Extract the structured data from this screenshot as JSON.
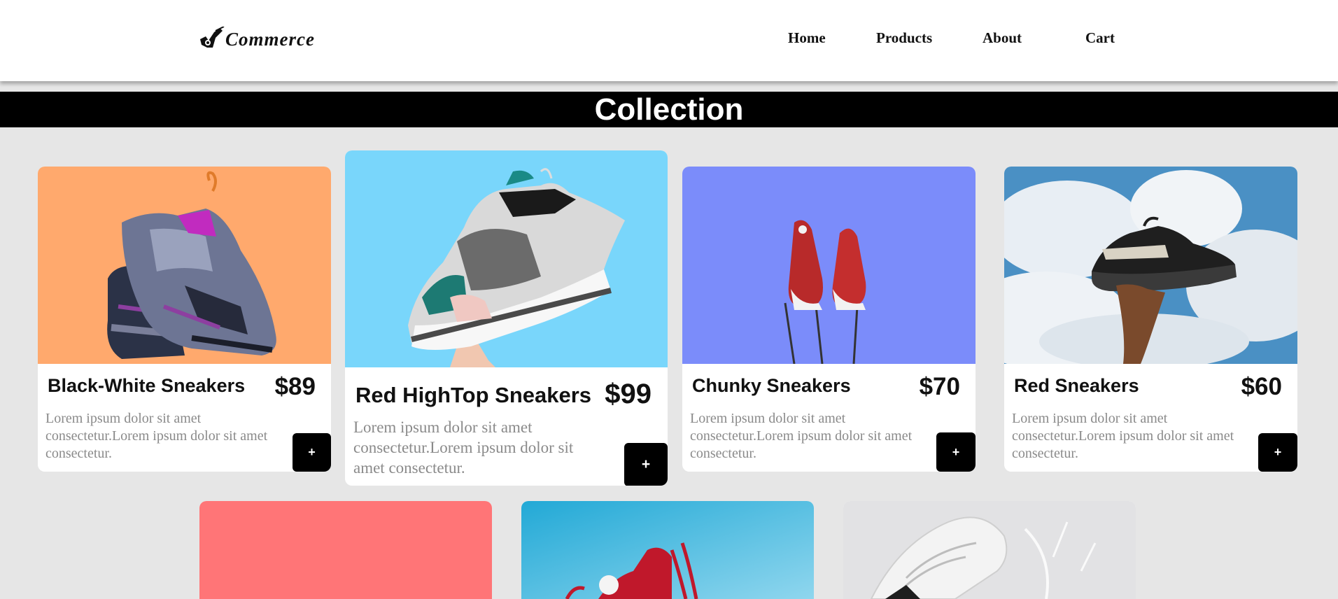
{
  "header": {
    "logo_text": "Commerce",
    "nav": [
      "Home",
      "Products",
      "About",
      "Cart"
    ]
  },
  "banner": {
    "title": "Collection"
  },
  "products": [
    {
      "name": "Black-White Sneakers",
      "price": "$89",
      "description": "Lorem ipsum dolor sit amet consectetur.Lorem ipsum dolor sit amet consectetur.",
      "button": "+",
      "bg_color": "#ffa96d"
    },
    {
      "name": "Red HighTop Sneakers",
      "price": "$99",
      "description": "Lorem ipsum dolor sit amet consectetur.Lorem ipsum dolor sit amet consectetur.",
      "button": "+",
      "bg_color": "#79d6fb"
    },
    {
      "name": "Chunky Sneakers",
      "price": "$70",
      "description": "Lorem ipsum dolor sit amet consectetur.Lorem ipsum dolor sit amet consectetur.",
      "button": "+",
      "bg_color": "#7b8cfa"
    },
    {
      "name": "Red Sneakers",
      "price": "$60",
      "description": "Lorem ipsum dolor sit amet consectetur.Lorem ipsum dolor sit amet consectetur.",
      "button": "+",
      "bg_color": "#4a90c4"
    }
  ],
  "second_row": [
    {
      "bg_color": "#ff7577"
    },
    {
      "bg_color": "#6fc6e6"
    },
    {
      "bg_color": "#e2e2e4"
    }
  ],
  "colors": {
    "page_bg": "#e6e6e6",
    "banner_bg": "#000000",
    "button_bg": "#000000",
    "text_muted": "#8a8a8a"
  }
}
